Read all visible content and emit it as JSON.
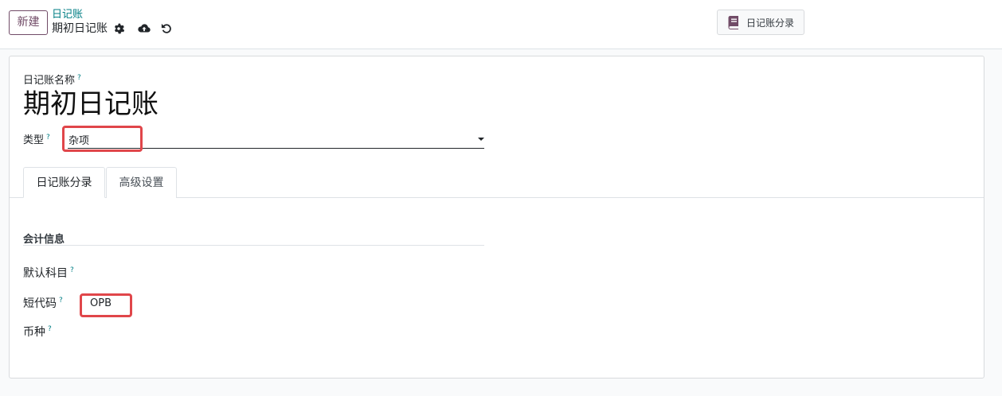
{
  "toolbar": {
    "new_button_label": "新建",
    "breadcrumb_parent": "日记账",
    "breadcrumb_current": "期初日记账",
    "icons": [
      "gear-icon",
      "cloud-upload-icon",
      "undo-icon"
    ]
  },
  "smart_button": {
    "label": "日记账分录",
    "icon": "book-icon",
    "icon_color": "#714b67"
  },
  "form": {
    "name_label": "日记账名称",
    "name_value": "期初日记账",
    "help_mark": "?",
    "type_label": "类型",
    "type_value": "杂项"
  },
  "tabs": [
    {
      "label": "日记账分录",
      "active": true
    },
    {
      "label": "高级设置",
      "active": false
    }
  ],
  "section": {
    "title": "会计信息",
    "fields": [
      {
        "label": "默认科目",
        "value": ""
      },
      {
        "label": "短代码",
        "value": "OPB"
      },
      {
        "label": "币种",
        "value": ""
      }
    ]
  },
  "colors": {
    "brand": "#714b67",
    "link": "#017e84",
    "highlight": "#e0464a"
  }
}
